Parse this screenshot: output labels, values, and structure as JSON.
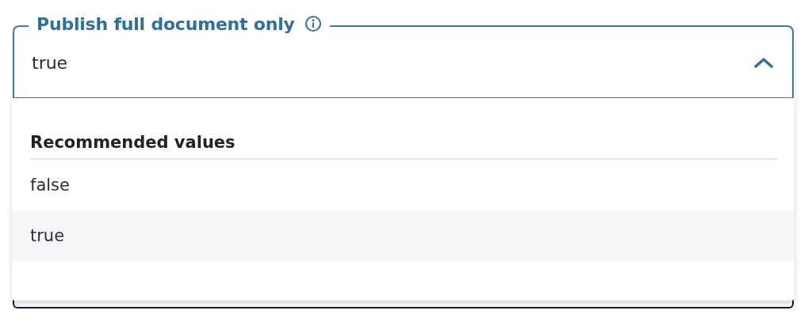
{
  "field": {
    "label": "Publish full document only",
    "value": "true",
    "expanded": true
  },
  "dropdown": {
    "heading": "Recommended values",
    "options": [
      {
        "label": "false",
        "selected": false
      },
      {
        "label": "true",
        "selected": true
      }
    ]
  }
}
